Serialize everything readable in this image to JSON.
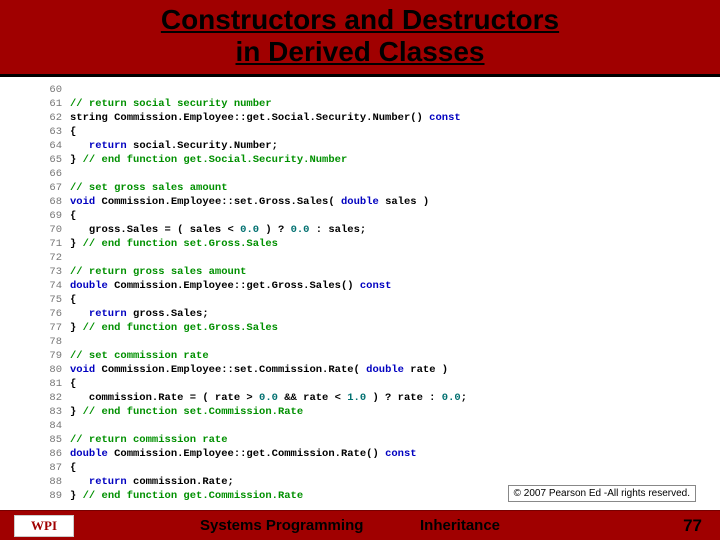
{
  "header": {
    "line1": "Constructors and Destructors",
    "line2": "in Derived Classes"
  },
  "code": [
    {
      "n": 60,
      "segs": []
    },
    {
      "n": 61,
      "segs": [
        {
          "c": "cm",
          "t": "// return social security number"
        }
      ]
    },
    {
      "n": 62,
      "segs": [
        {
          "c": "id",
          "t": "string Commission.Employee::get.Social.Security.Number() "
        },
        {
          "c": "kw",
          "t": "const"
        }
      ]
    },
    {
      "n": 63,
      "segs": [
        {
          "c": "id",
          "t": "{"
        }
      ]
    },
    {
      "n": 64,
      "segs": [
        {
          "c": "id",
          "t": "   "
        },
        {
          "c": "kw",
          "t": "return"
        },
        {
          "c": "id",
          "t": " social.Security.Number;"
        }
      ]
    },
    {
      "n": 65,
      "segs": [
        {
          "c": "id",
          "t": "} "
        },
        {
          "c": "cm",
          "t": "// end function get.Social.Security.Number"
        }
      ]
    },
    {
      "n": 66,
      "segs": []
    },
    {
      "n": 67,
      "segs": [
        {
          "c": "cm",
          "t": "// set gross sales amount"
        }
      ]
    },
    {
      "n": 68,
      "segs": [
        {
          "c": "kw",
          "t": "void"
        },
        {
          "c": "id",
          "t": " Commission.Employee::set.Gross.Sales( "
        },
        {
          "c": "kw",
          "t": "double"
        },
        {
          "c": "id",
          "t": " sales )"
        }
      ]
    },
    {
      "n": 69,
      "segs": [
        {
          "c": "id",
          "t": "{"
        }
      ]
    },
    {
      "n": 70,
      "segs": [
        {
          "c": "id",
          "t": "   gross.Sales = ( sales < "
        },
        {
          "c": "num",
          "t": "0.0"
        },
        {
          "c": "id",
          "t": " ) ? "
        },
        {
          "c": "num",
          "t": "0.0"
        },
        {
          "c": "id",
          "t": " : sales;"
        }
      ]
    },
    {
      "n": 71,
      "segs": [
        {
          "c": "id",
          "t": "} "
        },
        {
          "c": "cm",
          "t": "// end function set.Gross.Sales"
        }
      ]
    },
    {
      "n": 72,
      "segs": []
    },
    {
      "n": 73,
      "segs": [
        {
          "c": "cm",
          "t": "// return gross sales amount"
        }
      ]
    },
    {
      "n": 74,
      "segs": [
        {
          "c": "kw",
          "t": "double"
        },
        {
          "c": "id",
          "t": " Commission.Employee::get.Gross.Sales() "
        },
        {
          "c": "kw",
          "t": "const"
        }
      ]
    },
    {
      "n": 75,
      "segs": [
        {
          "c": "id",
          "t": "{"
        }
      ]
    },
    {
      "n": 76,
      "segs": [
        {
          "c": "id",
          "t": "   "
        },
        {
          "c": "kw",
          "t": "return"
        },
        {
          "c": "id",
          "t": " gross.Sales;"
        }
      ]
    },
    {
      "n": 77,
      "segs": [
        {
          "c": "id",
          "t": "} "
        },
        {
          "c": "cm",
          "t": "// end function get.Gross.Sales"
        }
      ]
    },
    {
      "n": 78,
      "segs": []
    },
    {
      "n": 79,
      "segs": [
        {
          "c": "cm",
          "t": "// set commission rate"
        }
      ]
    },
    {
      "n": 80,
      "segs": [
        {
          "c": "kw",
          "t": "void"
        },
        {
          "c": "id",
          "t": " Commission.Employee::set.Commission.Rate( "
        },
        {
          "c": "kw",
          "t": "double"
        },
        {
          "c": "id",
          "t": " rate )"
        }
      ]
    },
    {
      "n": 81,
      "segs": [
        {
          "c": "id",
          "t": "{"
        }
      ]
    },
    {
      "n": 82,
      "segs": [
        {
          "c": "id",
          "t": "   commission.Rate = ( rate > "
        },
        {
          "c": "num",
          "t": "0.0"
        },
        {
          "c": "id",
          "t": " && rate < "
        },
        {
          "c": "num",
          "t": "1.0"
        },
        {
          "c": "id",
          "t": " ) ? rate : "
        },
        {
          "c": "num",
          "t": "0.0"
        },
        {
          "c": "id",
          "t": ";"
        }
      ]
    },
    {
      "n": 83,
      "segs": [
        {
          "c": "id",
          "t": "} "
        },
        {
          "c": "cm",
          "t": "// end function set.Commission.Rate"
        }
      ]
    },
    {
      "n": 84,
      "segs": []
    },
    {
      "n": 85,
      "segs": [
        {
          "c": "cm",
          "t": "// return commission rate"
        }
      ]
    },
    {
      "n": 86,
      "segs": [
        {
          "c": "kw",
          "t": "double"
        },
        {
          "c": "id",
          "t": " Commission.Employee::get.Commission.Rate() "
        },
        {
          "c": "kw",
          "t": "const"
        }
      ]
    },
    {
      "n": 87,
      "segs": [
        {
          "c": "id",
          "t": "{"
        }
      ]
    },
    {
      "n": 88,
      "segs": [
        {
          "c": "id",
          "t": "   "
        },
        {
          "c": "kw",
          "t": "return"
        },
        {
          "c": "id",
          "t": " commission.Rate;"
        }
      ]
    },
    {
      "n": 89,
      "segs": [
        {
          "c": "id",
          "t": "} "
        },
        {
          "c": "cm",
          "t": "// end function get.Commission.Rate"
        }
      ]
    }
  ],
  "copyright": "© 2007 Pearson Ed -All rights reserved.",
  "footer": {
    "logo": "WPI",
    "left": "Systems Programming",
    "mid": "Inheritance",
    "page": "77"
  }
}
